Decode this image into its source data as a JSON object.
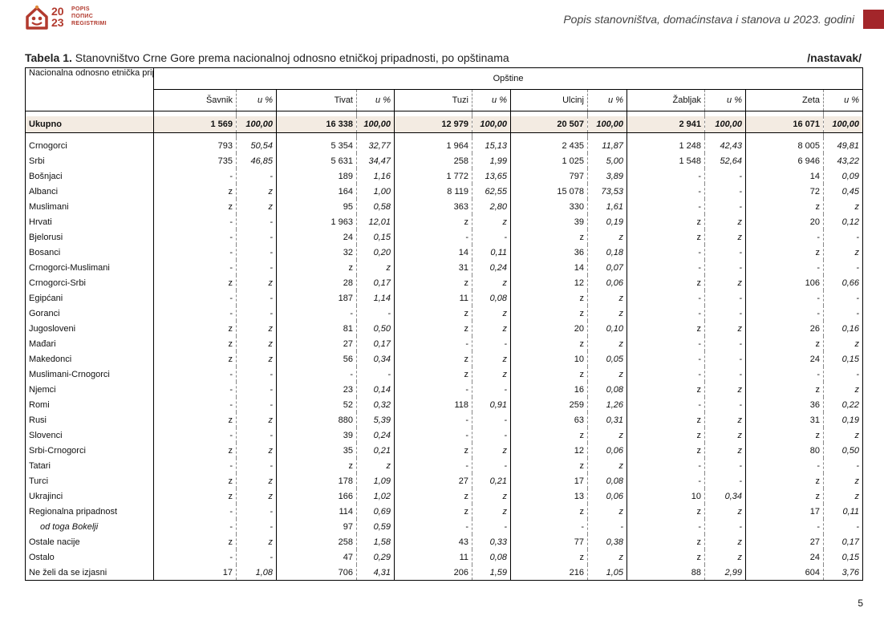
{
  "header": {
    "logo_year_top": "20",
    "logo_year_bottom": "23",
    "logo_word1": "POPIS",
    "logo_word2": "ПОПИС",
    "logo_word3": "REGISTRIMI",
    "title": "Popis stanovništva, domaćinstava i stanova u 2023. godini",
    "accent": "#a3262a"
  },
  "table_title_label": "Tabela 1.",
  "table_title_text": " Stanovništvo Crne Gore prema nacionalnoj odnosno etničkoj pripadnosti, po opštinama",
  "continuation": "/nastavak/",
  "row_header": "Nacionalna odnosno etnička pripadnost",
  "group_header": "Opštine",
  "municipalities": [
    "Šavnik",
    "Tivat",
    "Tuzi",
    "Ulcinj",
    "Žabljak",
    "Zeta"
  ],
  "pct_label": "u %",
  "total": {
    "label": "Ukupno",
    "cells": [
      "1 569",
      "100,00",
      "16 338",
      "100,00",
      "12 979",
      "100,00",
      "20 507",
      "100,00",
      "2 941",
      "100,00",
      "16 071",
      "100,00"
    ]
  },
  "rows": [
    {
      "label": "Crnogorci",
      "cells": [
        "793",
        "50,54",
        "5 354",
        "32,77",
        "1 964",
        "15,13",
        "2 435",
        "11,87",
        "1 248",
        "42,43",
        "8 005",
        "49,81"
      ]
    },
    {
      "label": "Srbi",
      "cells": [
        "735",
        "46,85",
        "5 631",
        "34,47",
        "258",
        "1,99",
        "1 025",
        "5,00",
        "1 548",
        "52,64",
        "6 946",
        "43,22"
      ]
    },
    {
      "label": "Bošnjaci",
      "cells": [
        "-",
        "-",
        "189",
        "1,16",
        "1 772",
        "13,65",
        "797",
        "3,89",
        "-",
        "-",
        "14",
        "0,09"
      ]
    },
    {
      "label": "Albanci",
      "cells": [
        "z",
        "z",
        "164",
        "1,00",
        "8 119",
        "62,55",
        "15 078",
        "73,53",
        "-",
        "-",
        "72",
        "0,45"
      ]
    },
    {
      "label": "Muslimani",
      "cells": [
        "z",
        "z",
        "95",
        "0,58",
        "363",
        "2,80",
        "330",
        "1,61",
        "-",
        "-",
        "z",
        "z"
      ]
    },
    {
      "label": "Hrvati",
      "cells": [
        "-",
        "-",
        "1 963",
        "12,01",
        "z",
        "z",
        "39",
        "0,19",
        "z",
        "z",
        "20",
        "0,12"
      ]
    },
    {
      "label": "Bjelorusi",
      "cells": [
        "-",
        "-",
        "24",
        "0,15",
        "-",
        "-",
        "z",
        "z",
        "z",
        "z",
        "-",
        "-"
      ]
    },
    {
      "label": "Bosanci",
      "cells": [
        "-",
        "-",
        "32",
        "0,20",
        "14",
        "0,11",
        "36",
        "0,18",
        "-",
        "-",
        "z",
        "z"
      ]
    },
    {
      "label": "Crnogorci-Muslimani",
      "cells": [
        "-",
        "-",
        "z",
        "z",
        "31",
        "0,24",
        "14",
        "0,07",
        "-",
        "-",
        "-",
        "-"
      ]
    },
    {
      "label": "Crnogorci-Srbi",
      "cells": [
        "z",
        "z",
        "28",
        "0,17",
        "z",
        "z",
        "12",
        "0,06",
        "z",
        "z",
        "106",
        "0,66"
      ]
    },
    {
      "label": "Egipćani",
      "cells": [
        "-",
        "-",
        "187",
        "1,14",
        "11",
        "0,08",
        "z",
        "z",
        "-",
        "-",
        "-",
        "-"
      ]
    },
    {
      "label": "Goranci",
      "cells": [
        "-",
        "-",
        "-",
        "-",
        "z",
        "z",
        "z",
        "z",
        "-",
        "-",
        "-",
        "-"
      ]
    },
    {
      "label": "Jugosloveni",
      "cells": [
        "z",
        "z",
        "81",
        "0,50",
        "z",
        "z",
        "20",
        "0,10",
        "z",
        "z",
        "26",
        "0,16"
      ]
    },
    {
      "label": "Mađari",
      "cells": [
        "z",
        "z",
        "27",
        "0,17",
        "-",
        "-",
        "z",
        "z",
        "-",
        "-",
        "z",
        "z"
      ]
    },
    {
      "label": "Makedonci",
      "cells": [
        "z",
        "z",
        "56",
        "0,34",
        "z",
        "z",
        "10",
        "0,05",
        "-",
        "-",
        "24",
        "0,15"
      ]
    },
    {
      "label": "Muslimani-Crnogorci",
      "cells": [
        "-",
        "-",
        "-",
        "-",
        "z",
        "z",
        "z",
        "z",
        "-",
        "-",
        "-",
        "-"
      ]
    },
    {
      "label": "Njemci",
      "cells": [
        "-",
        "-",
        "23",
        "0,14",
        "-",
        "-",
        "16",
        "0,08",
        "z",
        "z",
        "z",
        "z"
      ]
    },
    {
      "label": "Romi",
      "cells": [
        "-",
        "-",
        "52",
        "0,32",
        "118",
        "0,91",
        "259",
        "1,26",
        "-",
        "-",
        "36",
        "0,22"
      ]
    },
    {
      "label": "Rusi",
      "cells": [
        "z",
        "z",
        "880",
        "5,39",
        "-",
        "-",
        "63",
        "0,31",
        "z",
        "z",
        "31",
        "0,19"
      ]
    },
    {
      "label": "Slovenci",
      "cells": [
        "-",
        "-",
        "39",
        "0,24",
        "-",
        "-",
        "z",
        "z",
        "z",
        "z",
        "z",
        "z"
      ]
    },
    {
      "label": "Srbi-Crnogorci",
      "cells": [
        "z",
        "z",
        "35",
        "0,21",
        "z",
        "z",
        "12",
        "0,06",
        "z",
        "z",
        "80",
        "0,50"
      ]
    },
    {
      "label": "Tatari",
      "cells": [
        "-",
        "-",
        "z",
        "z",
        "-",
        "-",
        "z",
        "z",
        "-",
        "-",
        "-",
        "-"
      ]
    },
    {
      "label": "Turci",
      "cells": [
        "z",
        "z",
        "178",
        "1,09",
        "27",
        "0,21",
        "17",
        "0,08",
        "-",
        "-",
        "z",
        "z"
      ]
    },
    {
      "label": "Ukrajinci",
      "cells": [
        "z",
        "z",
        "166",
        "1,02",
        "z",
        "z",
        "13",
        "0,06",
        "10",
        "0,34",
        "z",
        "z"
      ]
    },
    {
      "label": "Regionalna pripadnost",
      "cells": [
        "-",
        "-",
        "114",
        "0,69",
        "z",
        "z",
        "z",
        "z",
        "z",
        "z",
        "17",
        "0,11"
      ]
    },
    {
      "label": "od toga Bokelji",
      "sub": true,
      "cells": [
        "-",
        "-",
        "97",
        "0,59",
        "-",
        "-",
        "-",
        "-",
        "-",
        "-",
        "-",
        "-"
      ]
    },
    {
      "label": "Ostale nacije",
      "cells": [
        "z",
        "z",
        "258",
        "1,58",
        "43",
        "0,33",
        "77",
        "0,38",
        "z",
        "z",
        "27",
        "0,17"
      ]
    },
    {
      "label": "Ostalo",
      "cells": [
        "-",
        "-",
        "47",
        "0,29",
        "11",
        "0,08",
        "z",
        "z",
        "z",
        "z",
        "24",
        "0,15"
      ]
    },
    {
      "label": "Ne želi da se izjasni",
      "cells": [
        "17",
        "1,08",
        "706",
        "4,31",
        "206",
        "1,59",
        "216",
        "1,05",
        "88",
        "2,99",
        "604",
        "3,76"
      ]
    }
  ],
  "page_number": "5"
}
